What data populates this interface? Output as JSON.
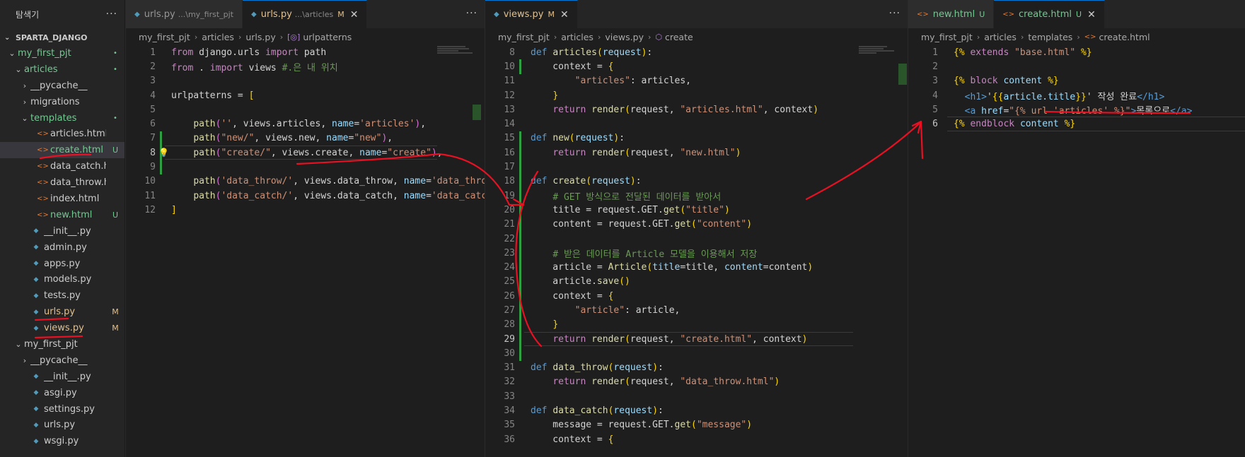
{
  "explorer": {
    "title": "탐색기",
    "more": "···",
    "root": "SPARTA_DJANGO",
    "items": [
      {
        "label": "my_first_pjt",
        "indent": 1,
        "kind": "folder-open",
        "color": "green",
        "marker": "•"
      },
      {
        "label": "articles",
        "indent": 2,
        "kind": "folder-open",
        "color": "green",
        "marker": "•"
      },
      {
        "label": "__pycache__",
        "indent": 3,
        "kind": "folder",
        "color": "white",
        "marker": ""
      },
      {
        "label": "migrations",
        "indent": 3,
        "kind": "folder",
        "color": "white",
        "marker": ""
      },
      {
        "label": "templates",
        "indent": 3,
        "kind": "folder-open",
        "color": "green",
        "marker": "•"
      },
      {
        "label": "articles.html",
        "indent": 4,
        "kind": "html",
        "color": "white",
        "marker": ""
      },
      {
        "label": "create.html",
        "indent": 4,
        "kind": "html",
        "color": "green",
        "marker": "U",
        "selected": true
      },
      {
        "label": "data_catch.html",
        "indent": 4,
        "kind": "html",
        "color": "white",
        "marker": ""
      },
      {
        "label": "data_throw.html",
        "indent": 4,
        "kind": "html",
        "color": "white",
        "marker": ""
      },
      {
        "label": "index.html",
        "indent": 4,
        "kind": "html",
        "color": "white",
        "marker": ""
      },
      {
        "label": "new.html",
        "indent": 4,
        "kind": "html",
        "color": "green",
        "marker": "U"
      },
      {
        "label": "__init__.py",
        "indent": 3,
        "kind": "py",
        "color": "white",
        "marker": ""
      },
      {
        "label": "admin.py",
        "indent": 3,
        "kind": "py",
        "color": "white",
        "marker": ""
      },
      {
        "label": "apps.py",
        "indent": 3,
        "kind": "py",
        "color": "white",
        "marker": ""
      },
      {
        "label": "models.py",
        "indent": 3,
        "kind": "py",
        "color": "white",
        "marker": ""
      },
      {
        "label": "tests.py",
        "indent": 3,
        "kind": "py",
        "color": "white",
        "marker": ""
      },
      {
        "label": "urls.py",
        "indent": 3,
        "kind": "py",
        "color": "mod",
        "marker": "M"
      },
      {
        "label": "views.py",
        "indent": 3,
        "kind": "py",
        "color": "mod",
        "marker": "M"
      },
      {
        "label": "my_first_pjt",
        "indent": 2,
        "kind": "folder-open",
        "color": "white",
        "marker": ""
      },
      {
        "label": "__pycache__",
        "indent": 3,
        "kind": "folder",
        "color": "white",
        "marker": ""
      },
      {
        "label": "__init__.py",
        "indent": 3,
        "kind": "py",
        "color": "white",
        "marker": ""
      },
      {
        "label": "asgi.py",
        "indent": 3,
        "kind": "py",
        "color": "white",
        "marker": ""
      },
      {
        "label": "settings.py",
        "indent": 3,
        "kind": "py",
        "color": "white",
        "marker": ""
      },
      {
        "label": "urls.py",
        "indent": 3,
        "kind": "py",
        "color": "white",
        "marker": ""
      },
      {
        "label": "wsgi.py",
        "indent": 3,
        "kind": "py",
        "color": "white",
        "marker": ""
      }
    ]
  },
  "group1": {
    "tabs": [
      {
        "label": "urls.py",
        "desc": "...\\my_first_pjt",
        "badge": "",
        "active": false,
        "icon": "python-icon"
      },
      {
        "label": "urls.py",
        "desc": "...\\articles",
        "badge": "M",
        "active": true,
        "icon": "python-icon"
      }
    ],
    "breadcrumb": [
      "my_first_pjt",
      "articles",
      "urls.py",
      "urlpatterns"
    ],
    "current_line": "8",
    "code": [
      {
        "n": "1",
        "html": "<span class='kw'>from</span> django.urls <span class='kw'>import</span> path"
      },
      {
        "n": "2",
        "html": "<span class='kw'>from</span> . <span class='kw'>import</span> views <span class='cmt'>#.은 내 위치</span>"
      },
      {
        "n": "3",
        "html": ""
      },
      {
        "n": "4",
        "html": "urlpatterns = <span class='br'>[</span>"
      },
      {
        "n": "5",
        "html": ""
      },
      {
        "n": "6",
        "html": "    <span class='fn'>path</span><span class='br2'>(</span><span class='str'>''</span>, views.articles, <span class='prm'>name</span>=<span class='str'>'articles'</span><span class='br2'>)</span>,"
      },
      {
        "n": "7",
        "html": "    <span class='fn'>path</span><span class='br2'>(</span><span class='str'>\"new/\"</span>, views.new, <span class='prm'>name</span>=<span class='str'>\"new\"</span><span class='br2'>)</span>,"
      },
      {
        "n": "8",
        "html": "    <span class='fn'>path</span><span class='br2'>(</span><span class='str'>\"create/\"</span>, views.create, <span class='prm'>name</span>=<span class='str'>\"create\"</span><span class='br2'>)</span>,"
      },
      {
        "n": "9",
        "html": ""
      },
      {
        "n": "10",
        "html": "    <span class='fn'>path</span><span class='br2'>(</span><span class='str'>'data_throw/'</span>, views.data_throw, <span class='prm'>name</span>=<span class='str'>'data_throw'</span><span class='br2'>)</span>,"
      },
      {
        "n": "11",
        "html": "    <span class='fn'>path</span><span class='br2'>(</span><span class='str'>'data_catch/'</span>, views.data_catch, <span class='prm'>name</span>=<span class='str'>'data_catch'</span><span class='br2'>)</span>,"
      },
      {
        "n": "12",
        "html": "<span class='br'>]</span>"
      }
    ]
  },
  "group2": {
    "tabs": [
      {
        "label": "views.py",
        "desc": "",
        "badge": "M",
        "active": true,
        "icon": "python-icon"
      }
    ],
    "breadcrumb": [
      "my_first_pjt",
      "articles",
      "views.py",
      "create"
    ],
    "current_line": "29",
    "code": [
      {
        "n": "8",
        "html": "<span class='def'>def</span> <span class='fn'>articles</span><span class='br'>(</span><span class='prm'>request</span><span class='br'>)</span>:"
      },
      {
        "n": "10",
        "html": "    context = <span class='br'>{</span>"
      },
      {
        "n": "11",
        "html": "        <span class='str'>\"articles\"</span>: articles,"
      },
      {
        "n": "12",
        "html": "    <span class='br'>}</span>"
      },
      {
        "n": "13",
        "html": "    <span class='kw'>return</span> <span class='fn'>render</span><span class='br'>(</span>request, <span class='str'>\"articles.html\"</span>, context<span class='br'>)</span>"
      },
      {
        "n": "14",
        "html": ""
      },
      {
        "n": "15",
        "html": "<span class='def'>def</span> <span class='fn'>new</span><span class='br'>(</span><span class='prm'>request</span><span class='br'>)</span>:"
      },
      {
        "n": "16",
        "html": "    <span class='kw'>return</span> <span class='fn'>render</span><span class='br'>(</span>request, <span class='str'>\"new.html\"</span><span class='br'>)</span>"
      },
      {
        "n": "17",
        "html": ""
      },
      {
        "n": "18",
        "html": "<span class='def'>def</span> <span class='fn'>create</span><span class='br'>(</span><span class='prm'>request</span><span class='br'>)</span>:"
      },
      {
        "n": "19",
        "html": "    <span class='cmt'># GET 방식으로 전달된 데이터를 받아서</span>"
      },
      {
        "n": "20",
        "html": "    title = request.GET.<span class='fn'>get</span><span class='br'>(</span><span class='str'>\"title\"</span><span class='br'>)</span>"
      },
      {
        "n": "21",
        "html": "    content = request.GET.<span class='fn'>get</span><span class='br'>(</span><span class='str'>\"content\"</span><span class='br'>)</span>"
      },
      {
        "n": "22",
        "html": ""
      },
      {
        "n": "23",
        "html": "    <span class='cmt'># 받은 데이터를 Article 모델을 이용해서 저장</span>"
      },
      {
        "n": "24",
        "html": "    article = <span class='fn'>Article</span><span class='br'>(</span><span class='prm'>title</span>=title, <span class='prm'>content</span>=content<span class='br'>)</span>"
      },
      {
        "n": "25",
        "html": "    article.<span class='fn'>save</span><span class='br'>()</span>"
      },
      {
        "n": "26",
        "html": "    context = <span class='br'>{</span>"
      },
      {
        "n": "27",
        "html": "        <span class='str'>\"article\"</span>: article,"
      },
      {
        "n": "28",
        "html": "    <span class='br'>}</span>"
      },
      {
        "n": "29",
        "html": "    <span class='kw'>return</span> <span class='fn'>render</span><span class='br'>(</span>request, <span class='str'>\"create.html\"</span>, context<span class='br'>)</span>"
      },
      {
        "n": "30",
        "html": ""
      },
      {
        "n": "31",
        "html": "<span class='def'>def</span> <span class='fn'>data_throw</span><span class='br'>(</span><span class='prm'>request</span><span class='br'>)</span>:"
      },
      {
        "n": "32",
        "html": "    <span class='kw'>return</span> <span class='fn'>render</span><span class='br'>(</span>request, <span class='str'>\"data_throw.html\"</span><span class='br'>)</span>"
      },
      {
        "n": "33",
        "html": ""
      },
      {
        "n": "34",
        "html": "<span class='def'>def</span> <span class='fn'>data_catch</span><span class='br'>(</span><span class='prm'>request</span><span class='br'>)</span>:"
      },
      {
        "n": "35",
        "html": "    message = request.GET.<span class='fn'>get</span><span class='br'>(</span><span class='str'>\"message\"</span><span class='br'>)</span>"
      },
      {
        "n": "36",
        "html": "    context = <span class='br'>{</span>"
      }
    ]
  },
  "group3": {
    "tabs": [
      {
        "label": "new.html",
        "desc": "",
        "badge": "U",
        "active": false,
        "icon": "html-icon"
      },
      {
        "label": "create.html",
        "desc": "",
        "badge": "U",
        "active": true,
        "icon": "html-icon",
        "close": "✕"
      }
    ],
    "breadcrumb": [
      "my_first_pjt",
      "articles",
      "templates",
      "create.html"
    ],
    "current_line": "6",
    "code": [
      {
        "n": "1",
        "html": "<span class='br'>{%</span> <span class='kw'>extends</span> <span class='str'>\"base.html\"</span> <span class='br'>%}</span>"
      },
      {
        "n": "2",
        "html": ""
      },
      {
        "n": "3",
        "html": "<span class='br'>{%</span> <span class='kw'>block</span> <span class='prm'>content</span> <span class='br'>%}</span>"
      },
      {
        "n": "4",
        "html": "  <span class='tag'>&lt;h1&gt;</span>'<span class='br'>{{</span><span class='prm'>article.title</span><span class='br'>}}</span>' 작성 완료<span class='tag'>&lt;/h1&gt;</span>"
      },
      {
        "n": "5",
        "html": "  <span class='tag'>&lt;a</span> <span class='attr'>href</span>=<span class='str'>\"{% url 'articles' %}\"</span><span class='tag'>&gt;</span>목록으로<span class='tag'>&lt;/a&gt;</span>"
      },
      {
        "n": "6",
        "html": "<span class='br'>{%</span> <span class='kw'>endblock</span> <span class='prm'>content</span> <span class='br'>%}</span>"
      }
    ]
  },
  "colors": {
    "background": "#1e1e1e",
    "sidebar": "#252526",
    "annotation": "#e81123",
    "untracked": "#73c991",
    "modified": "#e2c08d"
  }
}
